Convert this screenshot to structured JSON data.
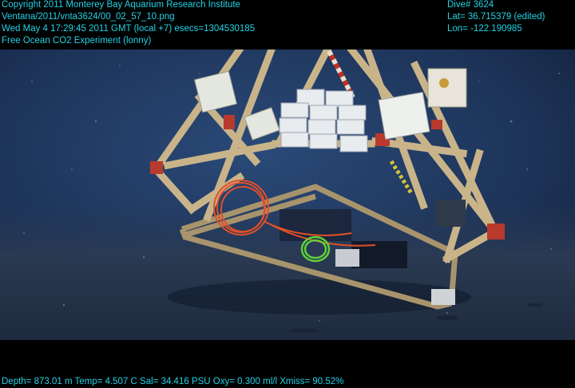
{
  "header": {
    "copyright": "Copyright 2011 Monterey Bay Aquarium Research Institute",
    "filename": "Ventana/2011/vnta3624/00_02_57_10.png",
    "datetime": "Wed May  4 17:29:45 2011 GMT (local +7)  esecs=1304530185",
    "experiment": "Free Ocean CO2 Experiment (lonny)",
    "dive": "Dive# 3624",
    "lat": "Lat= 36.715379 (edited)",
    "lon": "Lon= -122.190985"
  },
  "footer": {
    "telemetry": "Depth= 873.01 m  Temp= 4.507 C  Sal= 34.416 PSU  Oxy= 0.300 ml/l  Xmiss= 90.52%"
  },
  "colors": {
    "overlay_text": "#22d3e6",
    "water": "#1d3358",
    "seafloor": "#2a3a52",
    "frame_wood": "#c9b48a",
    "frame_red": "#b83a2c",
    "cable_orange": "#e0502a",
    "cable_green": "#5fd03a"
  }
}
